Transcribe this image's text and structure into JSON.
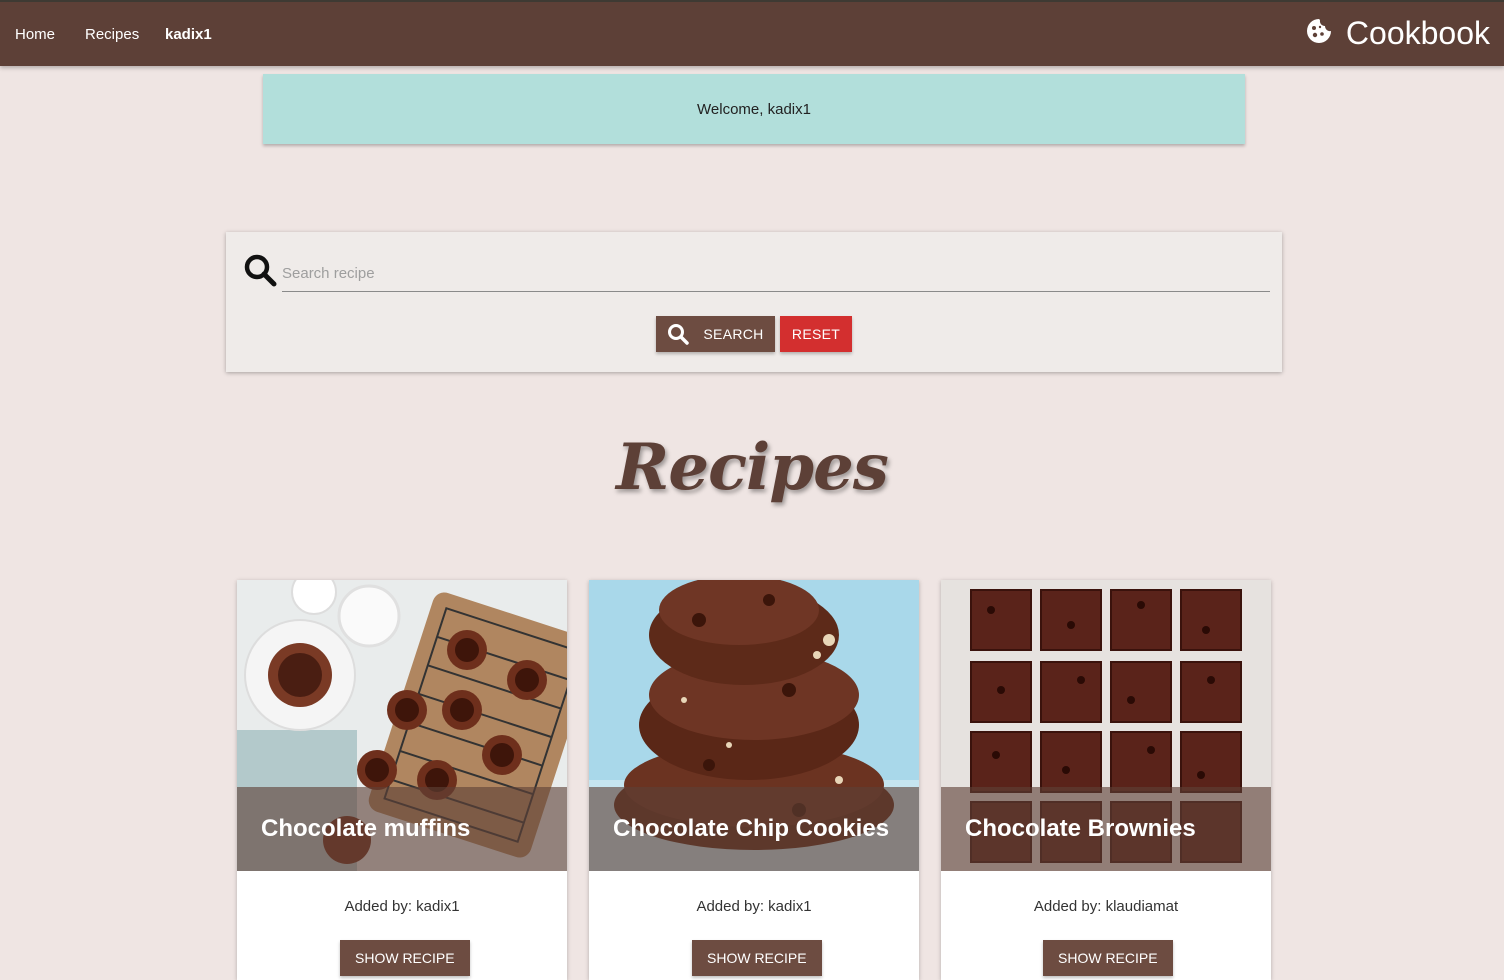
{
  "nav": {
    "items": [
      {
        "label": "Home"
      },
      {
        "label": "Recipes"
      },
      {
        "label": "kadix1"
      }
    ],
    "brand": "Cookbook"
  },
  "welcome": {
    "text": "Welcome, kadix1"
  },
  "search": {
    "placeholder": "Search recipe",
    "value": "",
    "search_label": "SEARCH",
    "reset_label": "RESET"
  },
  "recipes": {
    "title": "Recipes",
    "cards": [
      {
        "title": "Chocolate muffins",
        "added_by": "Added by: kadix1",
        "button": "SHOW RECIPE",
        "image": "muffins-photo"
      },
      {
        "title": "Chocolate Chip Cookies",
        "added_by": "Added by: kadix1",
        "button": "SHOW RECIPE",
        "image": "cookies-photo"
      },
      {
        "title": "Chocolate Brownies",
        "added_by": "Added by: klaudiamat",
        "button": "SHOW RECIPE",
        "image": "brownies-photo"
      }
    ]
  },
  "colors": {
    "navbar": "#5d4037",
    "background": "#efe5e3",
    "welcome": "#b2dfdb",
    "button": "#6d4c41",
    "reset": "#d32f2f"
  },
  "icons": {
    "brand": "cookie-icon",
    "search": "search-icon"
  }
}
